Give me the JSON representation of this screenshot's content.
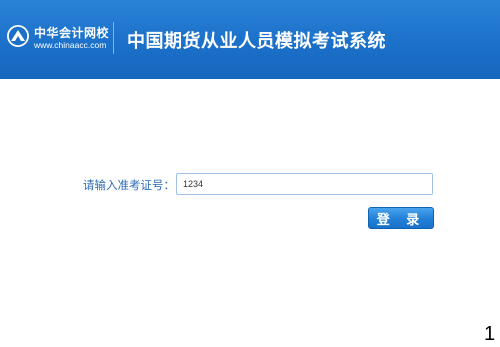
{
  "header": {
    "logo": {
      "icon": "chinaacc-logo-icon",
      "name": "中华会计网校",
      "url": "www.chinaacc.com"
    },
    "system_title": "中国期货从业人员模拟考试系统"
  },
  "login_form": {
    "label": "请输入准考证号：",
    "input_value": "1234",
    "submit_label": "登 录"
  },
  "page_number": "1",
  "colors": {
    "header_blue": "#1a6fc8",
    "label_blue": "#2d6cb5",
    "button_blue": "#2482d8",
    "input_border": "#9ec1e6"
  }
}
